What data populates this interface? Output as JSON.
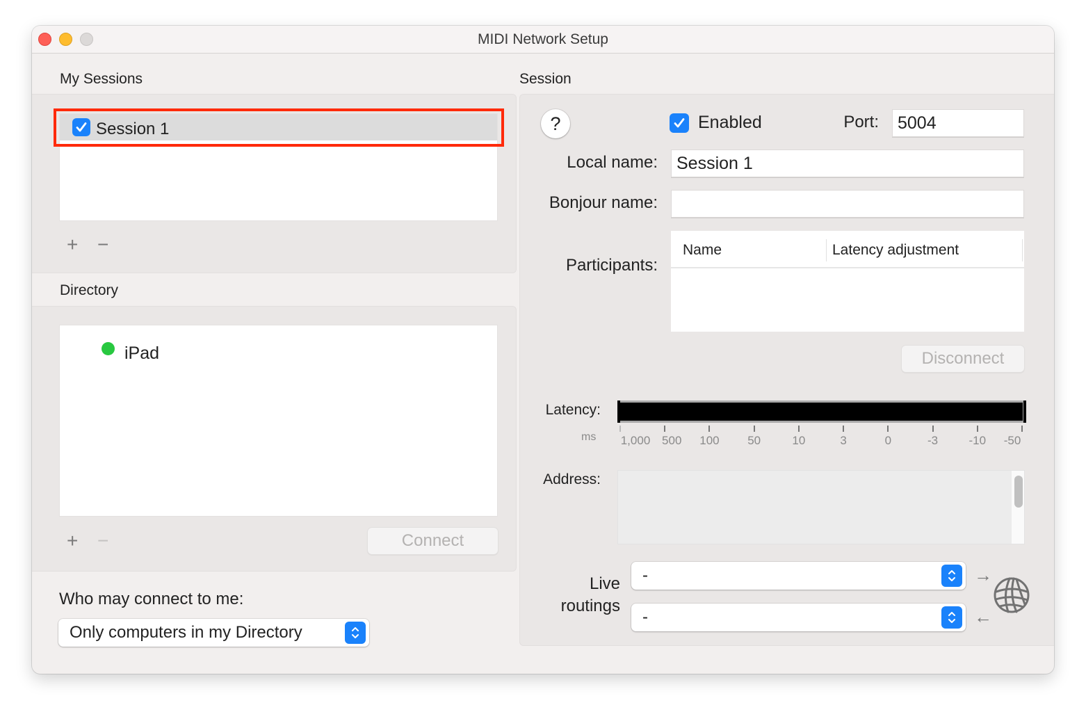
{
  "window": {
    "title": "MIDI Network Setup"
  },
  "my_sessions": {
    "heading": "My Sessions",
    "items": [
      {
        "label": "Session 1",
        "checked": true,
        "selected": true
      }
    ],
    "add_label": "+",
    "remove_label": "−"
  },
  "directory": {
    "heading": "Directory",
    "items": [
      {
        "label": "iPad",
        "status_color": "#28c840",
        "status": "online"
      }
    ],
    "add_label": "+",
    "remove_label": "−",
    "connect_label": "Connect"
  },
  "who_may_connect": {
    "label": "Who may connect to me:",
    "selected": "Only computers in my Directory"
  },
  "session": {
    "heading": "Session",
    "help_label": "?",
    "enabled_label": "Enabled",
    "enabled": true,
    "port_label": "Port:",
    "port_value": "5004",
    "local_name_label": "Local name:",
    "local_name_value": "Session 1",
    "bonjour_name_label": "Bonjour name:",
    "bonjour_name_value": "",
    "participants_label": "Participants:",
    "participants_columns": [
      "Name",
      "Latency adjustment"
    ],
    "participants_rows": [],
    "disconnect_label": "Disconnect",
    "latency_label": "Latency:",
    "latency_unit": "ms",
    "latency_ticks": [
      "1,000",
      "500",
      "100",
      "50",
      "10",
      "3",
      "0",
      "-3",
      "-10",
      "-50"
    ],
    "address_label": "Address:",
    "live_routings_label_line1": "Live",
    "live_routings_label_line2": "routings",
    "live_routing_out": "-",
    "live_routing_in": "-",
    "arrow_out": "→",
    "arrow_in": "←"
  },
  "colors": {
    "accent": "#1a82fb",
    "highlight": "#ff2a0a",
    "online": "#28c840"
  }
}
